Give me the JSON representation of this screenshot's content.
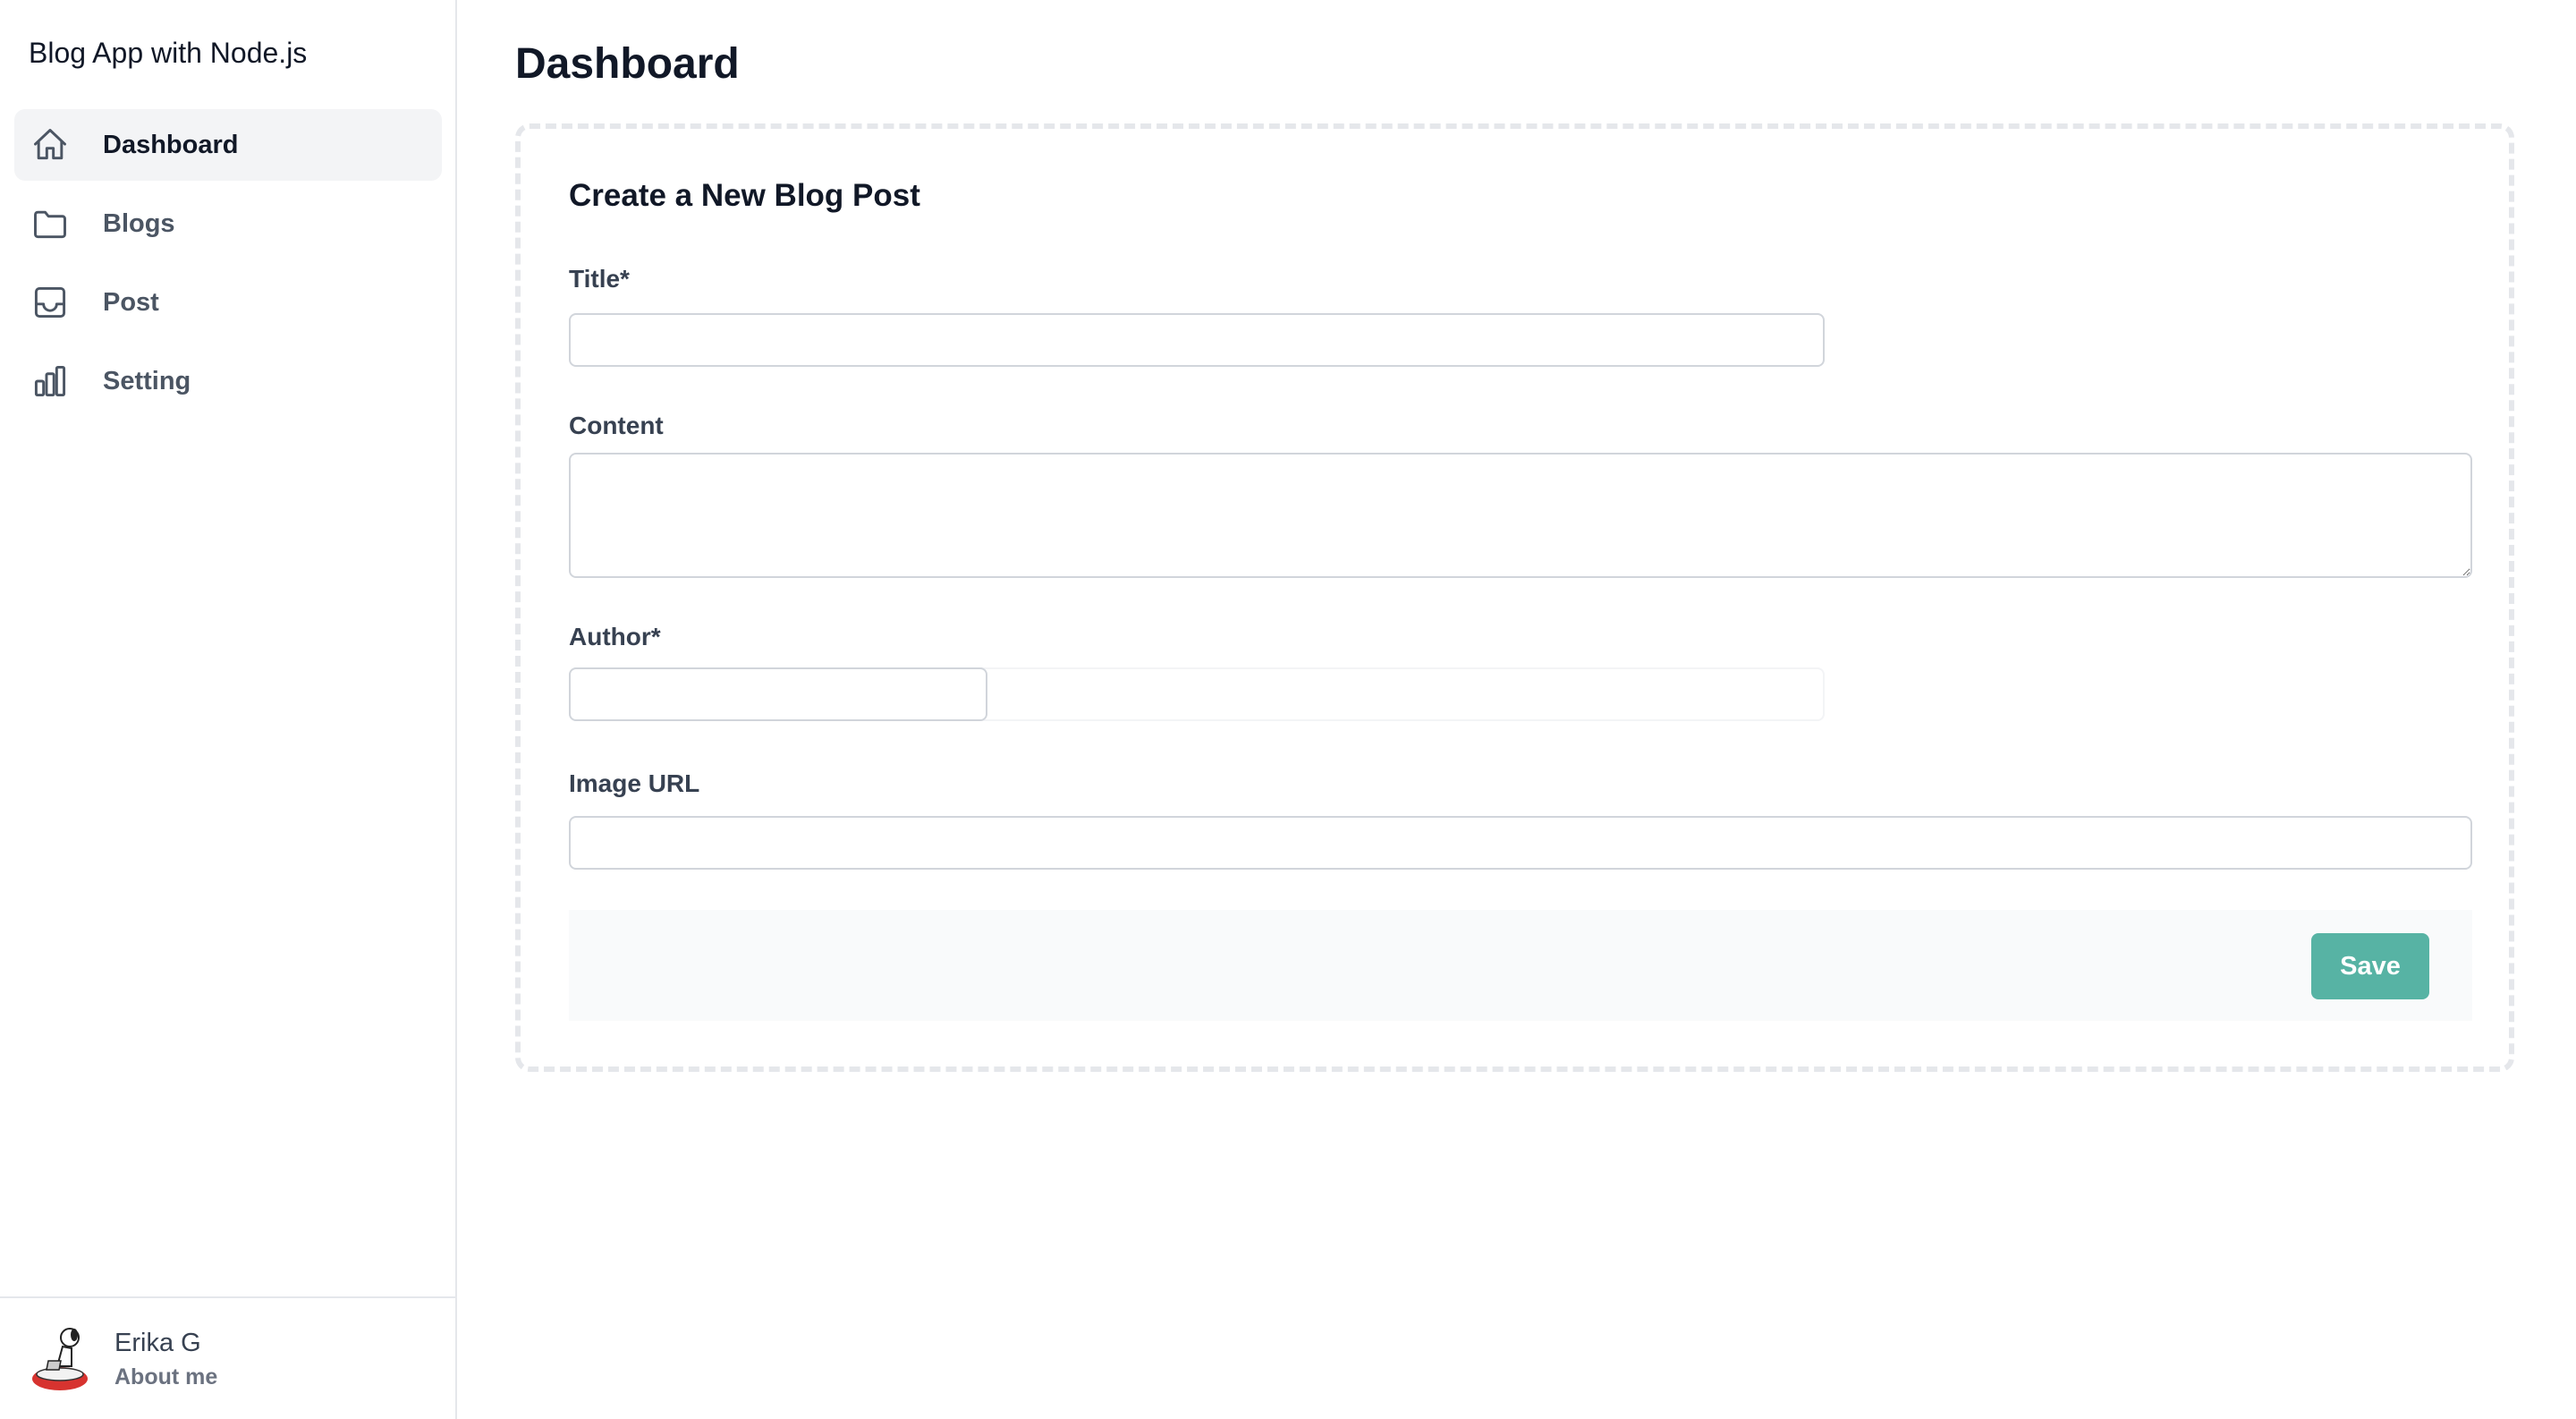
{
  "app": {
    "title": "Blog App with Node.js"
  },
  "sidebar": {
    "items": [
      {
        "label": "Dashboard",
        "icon": "home-icon",
        "active": true
      },
      {
        "label": "Blogs",
        "icon": "folder-icon",
        "active": false
      },
      {
        "label": "Post",
        "icon": "inbox-icon",
        "active": false
      },
      {
        "label": "Setting",
        "icon": "bar-chart-icon",
        "active": false
      }
    ],
    "user": {
      "name": "Erika G",
      "subtitle": "About me"
    }
  },
  "main": {
    "page_title": "Dashboard",
    "form": {
      "heading": "Create a New Blog Post",
      "title_label": "Title*",
      "title_value": "",
      "content_label": "Content",
      "content_value": "",
      "author_label": "Author*",
      "author_value": "",
      "image_label": "Image URL",
      "image_value": "",
      "save_label": "Save"
    }
  },
  "colors": {
    "accent": "#57b3a4",
    "active_nav_bg": "#f3f4f6",
    "border": "#e5e7eb",
    "footer_bg": "#f9fafb"
  }
}
